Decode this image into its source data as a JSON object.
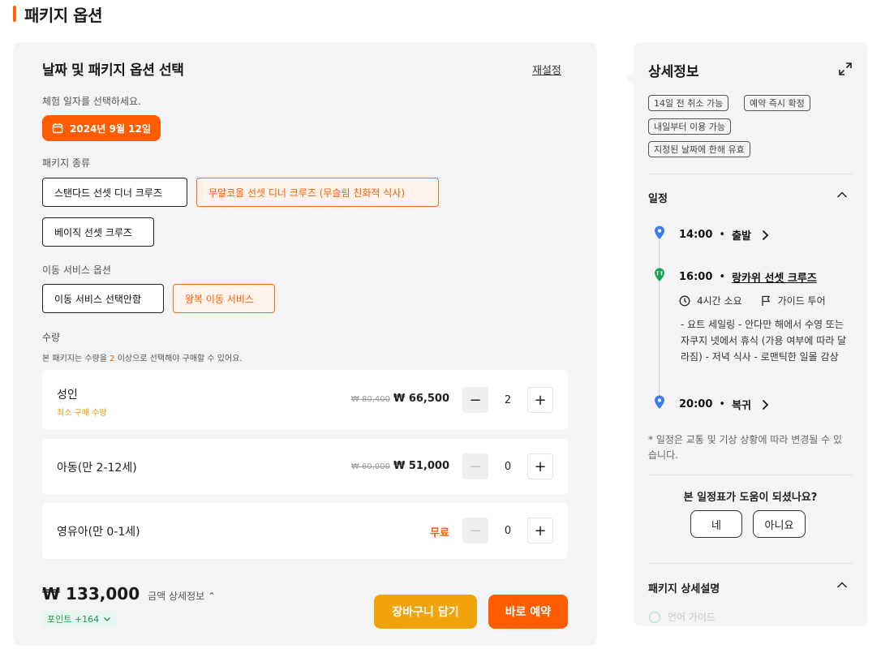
{
  "page": {
    "title": "패키지 옵션"
  },
  "left": {
    "title": "날짜 및 패키지 옵션 선택",
    "reset": "재설정",
    "date_label": "체험 일자를 선택하세요.",
    "date_value": "2024년 9월 12일",
    "package_label": "패키지 종류",
    "packages": [
      {
        "label": "스탠다드 선셋 디너 크루즈",
        "selected": false
      },
      {
        "label": "무알코올 선셋 디너 크루즈 (무슬림 친화적 식사)",
        "selected": true
      },
      {
        "label": "베이직 선셋 크루즈",
        "selected": false
      }
    ],
    "transport_label": "이동 서비스 옵션",
    "transport": [
      {
        "label": "이동 서비스 선택안함",
        "selected": false
      },
      {
        "label": "왕복 이동 서비스",
        "selected": true
      }
    ],
    "quantity_label": "수량",
    "quantity_note_pre": "본 패키지는 수량을 ",
    "quantity_note_num": "2",
    "quantity_note_post": " 이상으로 선택해야 구매할 수 있어요.",
    "rows": [
      {
        "label": "성인",
        "sub": "최소 구매 수량",
        "old_price": "₩ 80,400",
        "price": "₩ 66,500",
        "qty": "2"
      },
      {
        "label": "아동(만 2-12세)",
        "old_price": "₩ 60,000",
        "price": "₩ 51,000",
        "qty": "0"
      },
      {
        "label": "영유아(만 0-1세)",
        "free": "무료",
        "qty": "0"
      }
    ],
    "total": "₩ 133,000",
    "total_detail": "금액 상세정보",
    "points": "포인트 +164",
    "cart_button": "장바구니 담기",
    "buy_button": "바로 예약"
  },
  "right": {
    "title": "상세정보",
    "tags": [
      "14일 전 취소 가능",
      "예약 즉시 확정",
      "내일부터 이용 가능",
      "지정된 날짜에 한해 유효"
    ],
    "schedule_title": "일정",
    "timeline": [
      {
        "time": "14:00",
        "name": "출발"
      },
      {
        "time": "16:00",
        "name": "랑카위 선셋 크루즈"
      },
      {
        "time": "20:00",
        "name": "복귀"
      }
    ],
    "duration": "4시간 소요",
    "guide": "가이드 투어",
    "description": "- 요트 세일링 - 안다만 해에서 수영 또는 자쿠지 넷에서 휴식 (가용 여부에 따라 달라짐) - 저녁 식사 - 로맨틱한 일몰 감상",
    "note": "* 일정은 교통 및 기상 상황에 따라 변경될 수 있습니다.",
    "helpful_question": "본 일정표가 도움이 되셨나요?",
    "yes": "네",
    "no": "아니요",
    "package_detail_title": "패키지 상세설명",
    "faded_text": "언어 가이드"
  },
  "colors": {
    "accent": "#ff5c00",
    "cart": "#f0a30a",
    "pin_blue": "#3d7cf0",
    "pin_green": "#1aa355"
  },
  "sep": "•"
}
